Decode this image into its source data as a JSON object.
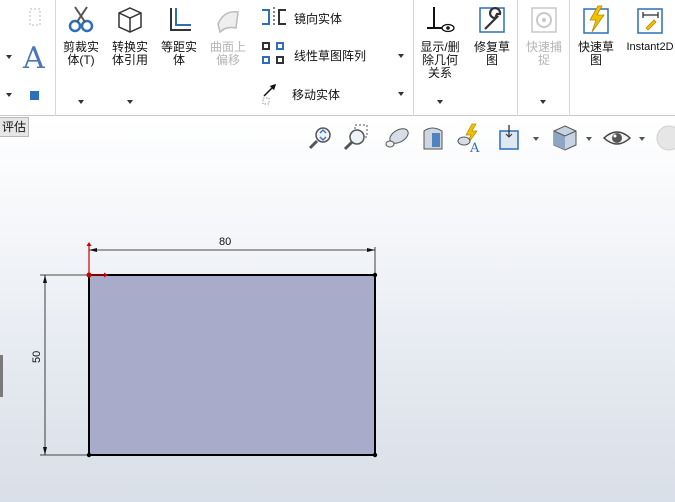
{
  "ribbon": {
    "trim_entities": "剪裁实\n体(T)",
    "convert_entities": "转换实\n体引用",
    "offset_entities": "等距实\n体",
    "offset_on_surface": "曲面上\n偏移",
    "mirror_entities": "镜向实体",
    "linear_pattern": "线性草图阵列",
    "move_entities": "移动实体",
    "display_delete_relations": "显示/删\n除几何\n关系",
    "repair_sketch": "修复草\n图",
    "quick_snaps": "快速捕\n捉",
    "rapid_sketch": "快速草\n图",
    "instant2d": "Instant2D"
  },
  "tab": {
    "label": "评估"
  },
  "sketch": {
    "width_dimension": "80",
    "height_dimension": "50",
    "rect_fill": "#a9abcb",
    "dimension_color": "#111111",
    "origin_color": "#cc0000"
  },
  "colors": {
    "accent_blue": "#2d6fb8",
    "disabled_gray": "#b5b5b5"
  }
}
